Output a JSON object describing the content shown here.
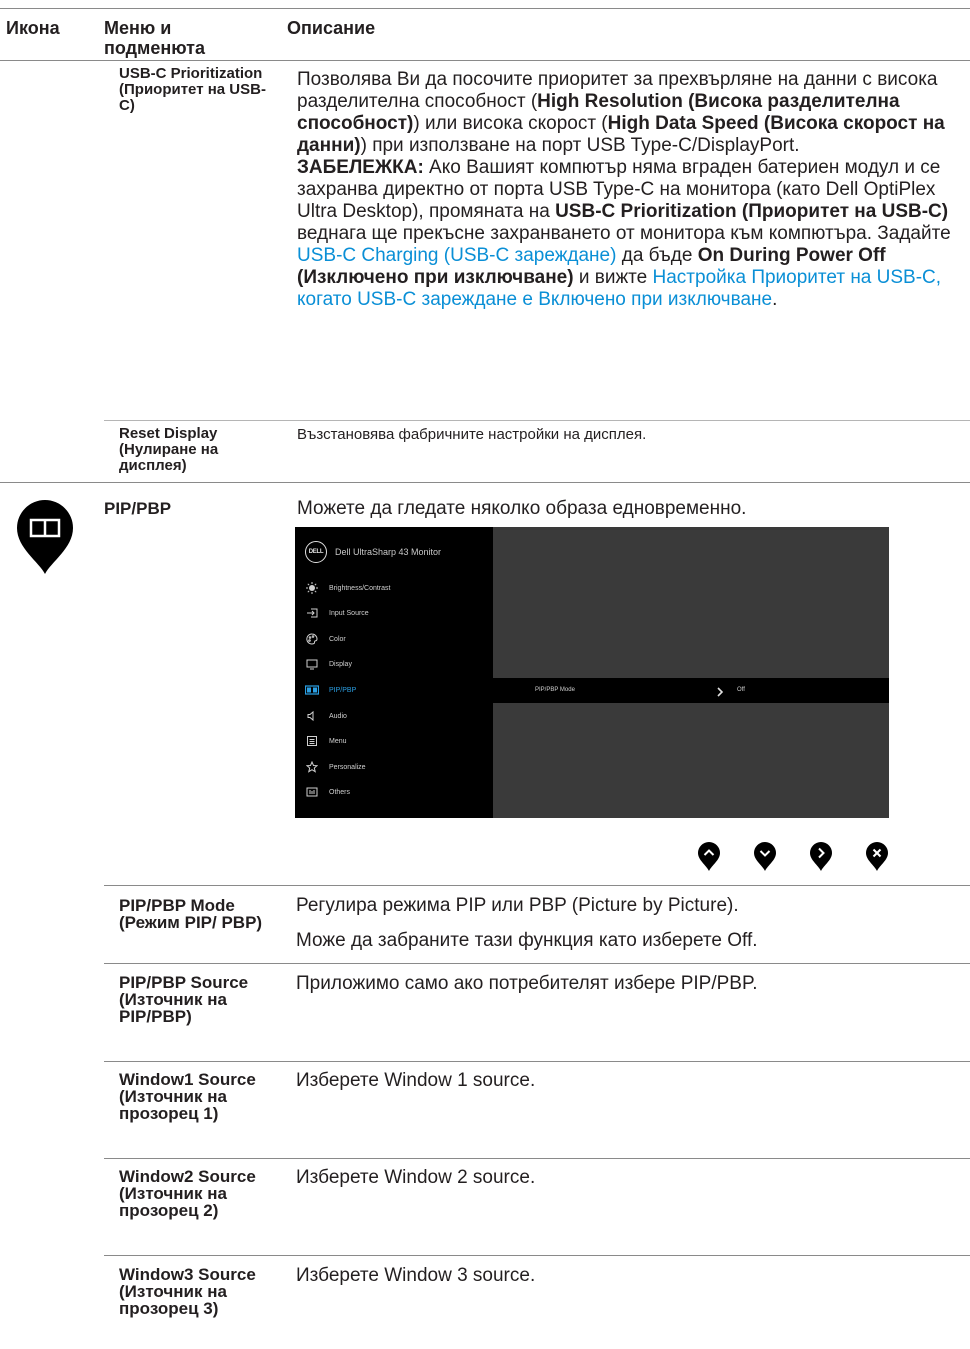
{
  "header": {
    "col_icon": "Икона",
    "col_menu": "Меню и подменюта",
    "col_desc": "Описание"
  },
  "usbc": {
    "menu": "USB-C Prioritization (Приоритет на USB-C)",
    "p1_a": "Позволява Ви да посочите приоритет за прехвърляне на данни с висока разделителна способност (",
    "p1_b": "High Resolution (Висока разделителна способност)",
    "p1_c": ") или висока скорост (",
    "p1_d": "High Data Speed (Висока скорост на данни)",
    "p1_e": ") при използване на порт USB Type-C/DisplayPort.",
    "note_label": "ЗАБЕЛЕЖКА:",
    "note_a": " Ако Вашият компютър няма вграден батериен модул и се захранва директно от порта USB Type-C на монитора (като Dell OptiPlex Ultra Desktop), промяната на ",
    "note_b": "USB-C Prioritization (Приоритет на USB-C)",
    "note_c": " веднага ще прекъсне захранването от монитора към компютъра. Задайте ",
    "note_link1": "USB-C Charging (USB-C зареждане)",
    "note_d": " да бъде ",
    "note_e": "On During Power Off (Изключено при изключване)",
    "note_f": " и вижте ",
    "note_link2": "Настройка Приоритет на USB-C, когато USB-C зареждане е Включено при изключване",
    "note_g": "."
  },
  "reset": {
    "menu": "Reset Display (Нулиране на дисплея)",
    "desc": "Възстановява фабричните настройки на дисплея."
  },
  "pip": {
    "menu": "PIP/PBP",
    "desc": "Можете да гледате няколко образа едновременно."
  },
  "osd": {
    "title": "Dell UltraSharp 43 Monitor",
    "logo": "DELL",
    "items": [
      {
        "label": "Brightness/Contrast",
        "icon": "brightness-icon"
      },
      {
        "label": "Input Source",
        "icon": "input-source-icon"
      },
      {
        "label": "Color",
        "icon": "color-icon"
      },
      {
        "label": "Display",
        "icon": "display-icon"
      },
      {
        "label": "PIP/PBP",
        "icon": "pip-pbp-icon"
      },
      {
        "label": "Audio",
        "icon": "audio-icon"
      },
      {
        "label": "Menu",
        "icon": "menu-icon"
      },
      {
        "label": "Personalize",
        "icon": "personalize-icon"
      },
      {
        "label": "Others",
        "icon": "others-icon"
      }
    ],
    "selected_item": "PIP/PBP",
    "row_label": "PIP/PBP Mode",
    "row_value": "Off"
  },
  "joystick_icons": [
    "up-icon",
    "down-icon",
    "right-icon",
    "close-icon"
  ],
  "rows": [
    {
      "menu": "PIP/PBP Mode (Режим PIP/ PBP)",
      "desc1": "Регулира режима PIP или PBP (Picture by Picture).",
      "desc2": "Може да забраните тази функция като изберете Off."
    },
    {
      "menu": "PIP/PBP Source (Източник на PIP/PBP)",
      "desc1": "Приложимо само ако потребителят избере PIP/PBP."
    },
    {
      "menu": "Window1 Source (Източник на прозорец 1)",
      "desc1": "Изберете Window 1 source."
    },
    {
      "menu": "Window2 Source (Източник на прозорец 2)",
      "desc1": "Изберете Window 2 source."
    },
    {
      "menu": "Window3 Source (Източник на прозорец 3)",
      "desc1": "Изберете Window 3 source."
    }
  ],
  "colors": {
    "link": "#0a8fd6",
    "osd_active": "#2b9fe3",
    "osd_bg": "#3a3a3a"
  }
}
